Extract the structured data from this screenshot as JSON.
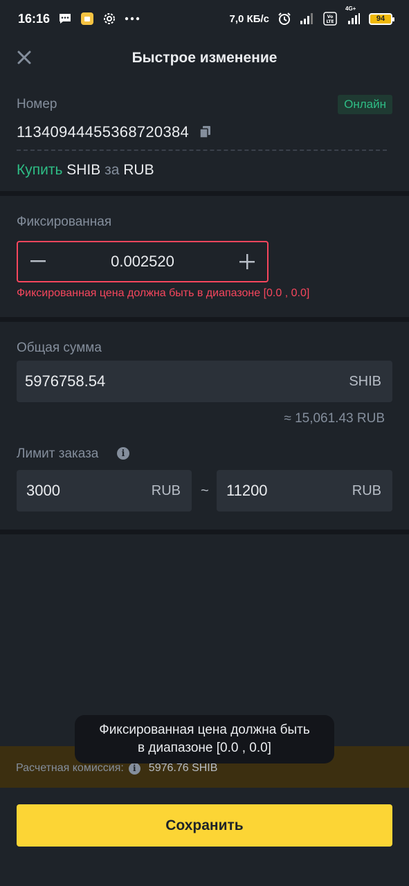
{
  "status_bar": {
    "time": "16:16",
    "network_speed": "7,0 КБ/с",
    "lte_label": "4G+",
    "battery": "94",
    "icons": [
      "message-icon",
      "app-notification-icon",
      "settings-icon",
      "more-icon",
      "alarm-icon",
      "signal-icon",
      "volte-icon",
      "battery-icon"
    ]
  },
  "header": {
    "title": "Быстрое изменение",
    "close_icon": "close-icon"
  },
  "order": {
    "number_label": "Номер",
    "status_badge": "Онлайн",
    "number": "11340944455368720384",
    "buy_word": "Купить",
    "asset": "SHIB",
    "for_word": "за",
    "fiat": "RUB"
  },
  "price": {
    "label": "Фиксированная",
    "value": "0.002520",
    "error": "Фиксированная цена должна быть в диапазоне [0.0 , 0.0]"
  },
  "total": {
    "label": "Общая сумма",
    "value": "5976758.54",
    "unit": "SHIB",
    "approx": "≈ 15,061.43 RUB"
  },
  "limit": {
    "label": "Лимит заказа",
    "min_value": "3000",
    "min_unit": "RUB",
    "separator": "~",
    "max_value": "11200",
    "max_unit": "RUB"
  },
  "fee": {
    "label": "Расчетная комиссия:",
    "value": "5976.76 SHIB"
  },
  "toast": {
    "message": "Фиксированная цена должна быть в диапазоне [0.0 , 0.0]"
  },
  "save_button": {
    "label": "Сохранить"
  },
  "colors": {
    "background": "#1e2329",
    "accent": "#fcd535",
    "positive": "#2ebd85",
    "error": "#f6465d"
  }
}
